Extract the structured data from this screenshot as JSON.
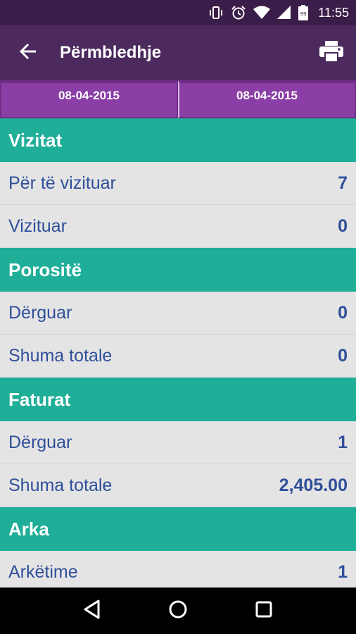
{
  "status_bar": {
    "time": "11:55",
    "icons": [
      "vibrate-icon",
      "alarm-icon",
      "wifi-icon",
      "signal-icon",
      "battery-icon"
    ]
  },
  "app_bar": {
    "title": "Përmbledhje",
    "back_icon": "arrow-back-icon",
    "print_icon": "print-icon"
  },
  "date_range": {
    "from": "08-04-2015",
    "to": "08-04-2015"
  },
  "sections": [
    {
      "title": "Vizitat",
      "rows": [
        {
          "label": "Për të vizituar",
          "value": "7"
        },
        {
          "label": "Vizituar",
          "value": "0"
        }
      ]
    },
    {
      "title": "Porositë",
      "rows": [
        {
          "label": "Dërguar",
          "value": "0"
        },
        {
          "label": "Shuma totale",
          "value": "0"
        }
      ]
    },
    {
      "title": "Faturat",
      "rows": [
        {
          "label": "Dërguar",
          "value": "1"
        },
        {
          "label": "Shuma totale",
          "value": "2,405.00"
        }
      ]
    },
    {
      "title": "Arka",
      "rows": [
        {
          "label": "Arkëtime",
          "value": "1"
        }
      ]
    }
  ],
  "nav_bar": {
    "icons": [
      "back-triangle-icon",
      "home-circle-icon",
      "recents-square-icon"
    ]
  },
  "colors": {
    "status_bar": "#3b1d49",
    "app_bar": "#4c2a5e",
    "date_tab": "#8b3fa6",
    "section_header": "#1fae98",
    "row_background": "#e4e4e4",
    "row_text": "#2f4f9a"
  }
}
